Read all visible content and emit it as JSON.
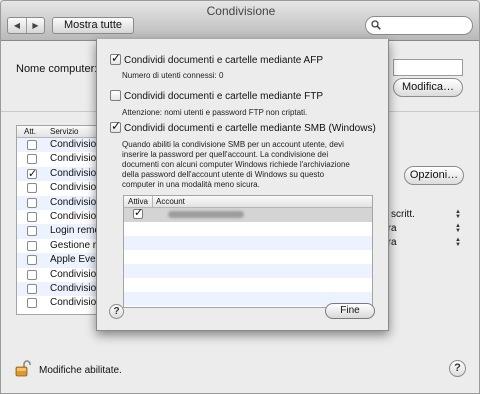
{
  "window": {
    "title": "Condivisione"
  },
  "toolbar": {
    "show_all_label": "Mostra tutte",
    "search_placeholder": ""
  },
  "main": {
    "computer_name_label": "Nome computer:",
    "modify_button": "Modifica…",
    "options_button": "Opzioni…",
    "services_table": {
      "columns": [
        "Att.",
        "Servizio"
      ],
      "rows": [
        {
          "checked": false,
          "name": "Condivisione"
        },
        {
          "checked": false,
          "name": "Condivisione"
        },
        {
          "checked": true,
          "name": "Condivisione"
        },
        {
          "checked": false,
          "name": "Condivisione"
        },
        {
          "checked": false,
          "name": "Condivisione"
        },
        {
          "checked": false,
          "name": "Condivisione"
        },
        {
          "checked": false,
          "name": "Login remo"
        },
        {
          "checked": false,
          "name": "Gestione re"
        },
        {
          "checked": false,
          "name": "Apple Even"
        },
        {
          "checked": false,
          "name": "Condivisione"
        },
        {
          "checked": false,
          "name": "Condivisione"
        },
        {
          "checked": false,
          "name": "Condivisione"
        }
      ]
    },
    "permissions": [
      "ra e scritt.",
      "ettura",
      "ettura"
    ]
  },
  "footer": {
    "lock_label": "Modifiche abilitate."
  },
  "sheet": {
    "afp_label": "Condividi documenti e cartelle mediante AFP",
    "afp_checked": true,
    "afp_note": "Numero di utenti connessi: 0",
    "ftp_label": "Condividi documenti e cartelle mediante FTP",
    "ftp_checked": false,
    "ftp_note": "Attenzione: nomi utenti e password FTP non criptati.",
    "smb_label": "Condividi documenti e cartelle mediante SMB (Windows)",
    "smb_checked": true,
    "smb_description": "Quando abiliti la condivisione SMB per un account utente, devi\ninserire la password per quell'account. La condivisione dei\ndocumenti con alcuni computer Windows richiede l'archiviazione\ndella password dell'account utente di Windows su questo\ncomputer in una modalità meno sicura.",
    "accounts_table": {
      "columns": [
        "Attiva",
        "Account"
      ],
      "rows": [
        {
          "active": true,
          "account": ""
        }
      ]
    },
    "done_button": "Fine"
  },
  "colors": {
    "selection_row": "#d4d4d4",
    "alt_row": "#edf3fe"
  }
}
